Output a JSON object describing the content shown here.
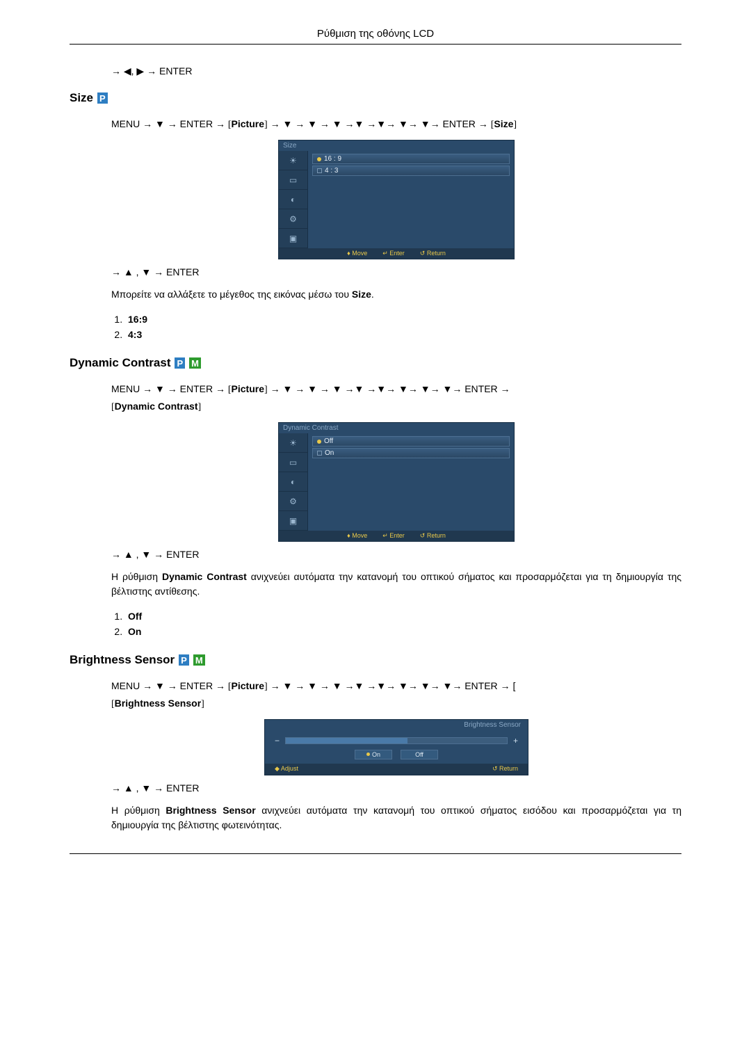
{
  "header": {
    "title": "Ρύθμιση της οθόνης LCD"
  },
  "nav_enter_lr": "→ ◀, ▶ → ENTER",
  "nav_enter_ud": "→ ▲ , ▼ → ENTER",
  "size": {
    "heading": "Size",
    "badge_p": "P",
    "path_prefix": "MENU → ▼ → ENTER → ",
    "path_pic": "Picture",
    "path_mid": " → ▼ → ▼ → ▼ →▼ →▼→ ▼→ ▼→ ENTER → ",
    "path_end": "Size",
    "osd_title": "Size",
    "osd_opt1": "16 : 9",
    "osd_opt2": "4 : 3",
    "osd_footer_move": "♦ Move",
    "osd_footer_enter": "↵ Enter",
    "osd_footer_return": "↺ Return",
    "body": "Μπορείτε να αλλάξετε το μέγεθος της εικόνας μέσω του ",
    "body_bold": "Size",
    "body_end": ".",
    "list1": "16:9",
    "list2": "4:3"
  },
  "dynamic": {
    "heading": "Dynamic Contrast",
    "badge_p": "P",
    "badge_m": "M",
    "path_prefix": "MENU → ▼ → ENTER → ",
    "path_pic": "Picture",
    "path_mid": " → ▼ → ▼ → ▼ →▼ →▼→ ▼→ ▼→ ▼→ ENTER → ",
    "path_end": "Dynamic Contrast",
    "osd_title": "Dynamic Contrast",
    "osd_opt1": "Off",
    "osd_opt2": "On",
    "osd_footer_move": "♦ Move",
    "osd_footer_enter": "↵ Enter",
    "osd_footer_return": "↺ Return",
    "body1": "Η ρύθμιση ",
    "body_bold": "Dynamic Contrast",
    "body2": " ανιχνεύει αυτόματα την κατανομή του οπτικού σήματος και προσαρμόζεται για τη δημιουργία της βέλτιστης αντίθεσης.",
    "list1": "Off",
    "list2": "On"
  },
  "brightness": {
    "heading": "Brightness Sensor",
    "badge_p": "P",
    "badge_m": "M",
    "path_prefix": "MENU → ▼ → ENTER → ",
    "path_pic": "Picture",
    "path_mid": " → ▼ → ▼ → ▼ →▼ →▼→ ▼→ ▼→ ▼→ ENTER → [",
    "path_end": "Brightness Sensor",
    "osd_title": "Brightness Sensor",
    "btn_on": "On",
    "btn_off": "Off",
    "footer_adjust": "◆ Adjust",
    "footer_return": "↺ Return",
    "body1": "Η ρύθμιση ",
    "body_bold": "Brightness Sensor",
    "body2": " ανιχνεύει αυτόματα την κατανομή του οπτικού σήματος εισόδου και προσαρμόζεται για τη δημιουργία της βέλτιστης φωτεινότητας."
  }
}
